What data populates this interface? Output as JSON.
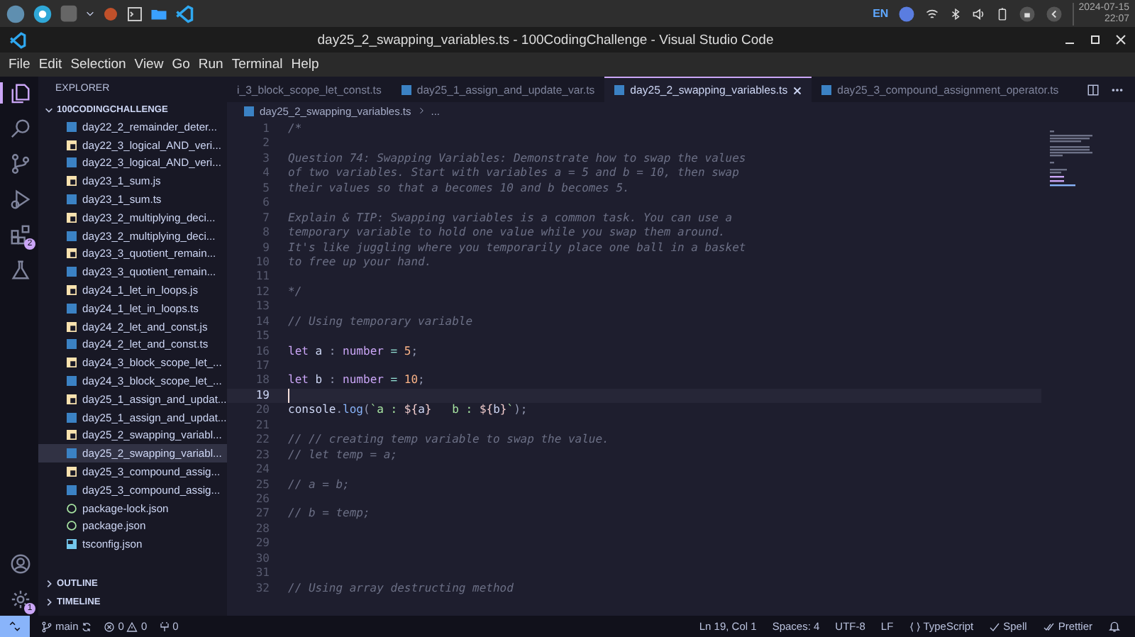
{
  "taskbar": {
    "language": "EN",
    "date": "2024-07-15",
    "time": "22:07"
  },
  "window": {
    "title": "day25_2_swapping_variables.ts - 100CodingChallenge - Visual Studio Code"
  },
  "menu": [
    "File",
    "Edit",
    "Selection",
    "View",
    "Go",
    "Run",
    "Terminal",
    "Help"
  ],
  "activity_bar": [
    {
      "kind": "explorer",
      "selected": true
    },
    {
      "kind": "search",
      "selected": false
    },
    {
      "kind": "source-control",
      "selected": false
    },
    {
      "kind": "run-debug",
      "selected": false
    },
    {
      "kind": "extensions",
      "selected": false,
      "badge": "2"
    },
    {
      "kind": "testing",
      "selected": false
    }
  ],
  "activity_bar_bottom": [
    {
      "kind": "account"
    },
    {
      "kind": "settings",
      "badge": "1"
    }
  ],
  "sidebar": {
    "title": "EXPLORER",
    "folder": {
      "name": "100CODINGCHALLENGE",
      "expanded": true
    },
    "files": [
      {
        "name": "day22_2_remainder_deter...",
        "kind": "ts",
        "selected": false
      },
      {
        "name": "day22_3_logical_AND_veri...",
        "kind": "js",
        "selected": false
      },
      {
        "name": "day22_3_logical_AND_veri...",
        "kind": "ts",
        "selected": false
      },
      {
        "name": "day23_1_sum.js",
        "kind": "js",
        "selected": false
      },
      {
        "name": "day23_1_sum.ts",
        "kind": "ts",
        "selected": false
      },
      {
        "name": "day23_2_multiplying_deci...",
        "kind": "js",
        "selected": false
      },
      {
        "name": "day23_2_multiplying_deci...",
        "kind": "ts",
        "selected": false
      },
      {
        "name": "day23_3_quotient_remain...",
        "kind": "js",
        "selected": false
      },
      {
        "name": "day23_3_quotient_remain...",
        "kind": "ts",
        "selected": false
      },
      {
        "name": "day24_1_let_in_loops.js",
        "kind": "js",
        "selected": false
      },
      {
        "name": "day24_1_let_in_loops.ts",
        "kind": "ts",
        "selected": false
      },
      {
        "name": "day24_2_let_and_const.js",
        "kind": "js",
        "selected": false
      },
      {
        "name": "day24_2_let_and_const.ts",
        "kind": "ts",
        "selected": false
      },
      {
        "name": "day24_3_block_scope_let_...",
        "kind": "js",
        "selected": false
      },
      {
        "name": "day24_3_block_scope_let_...",
        "kind": "ts",
        "selected": false
      },
      {
        "name": "day25_1_assign_and_updat...",
        "kind": "js",
        "selected": false
      },
      {
        "name": "day25_1_assign_and_updat...",
        "kind": "ts",
        "selected": false
      },
      {
        "name": "day25_2_swapping_variabl...",
        "kind": "js",
        "selected": false
      },
      {
        "name": "day25_2_swapping_variabl...",
        "kind": "ts",
        "selected": true
      },
      {
        "name": "day25_3_compound_assig...",
        "kind": "js",
        "selected": false
      },
      {
        "name": "day25_3_compound_assig...",
        "kind": "ts",
        "selected": false
      },
      {
        "name": "package-lock.json",
        "kind": "json",
        "selected": false
      },
      {
        "name": "package.json",
        "kind": "json",
        "selected": false
      },
      {
        "name": "tsconfig.json",
        "kind": "tsconfig",
        "selected": false
      }
    ],
    "sections": [
      {
        "label": "OUTLINE",
        "expanded": false
      },
      {
        "label": "TIMELINE",
        "expanded": false
      }
    ]
  },
  "tabs": [
    {
      "label": "i_3_block_scope_let_const.ts",
      "selected": false
    },
    {
      "label": "day25_1_assign_and_update_var.ts",
      "selected": false
    },
    {
      "label": "day25_2_swapping_variables.ts",
      "selected": true
    },
    {
      "label": "day25_3_compound_assignment_operator.ts",
      "selected": false
    }
  ],
  "breadcrumb": [
    "day25_2_swapping_variables.ts",
    "..."
  ],
  "code_lines": [
    {
      "number": "1",
      "current": false,
      "tokens": [
        {
          "kind": "comment",
          "text": "/*"
        }
      ]
    },
    {
      "number": "2",
      "current": false
    },
    {
      "number": "3",
      "current": false,
      "tokens": [
        {
          "kind": "comment",
          "text": "Question 74: Swapping Variables: Demonstrate how to swap the values"
        }
      ]
    },
    {
      "number": "4",
      "current": false,
      "tokens": [
        {
          "kind": "comment",
          "text": "of two variables. Start with variables a = 5 and b = 10, then swap"
        }
      ]
    },
    {
      "number": "5",
      "current": false,
      "tokens": [
        {
          "kind": "comment",
          "text": "their values so that a becomes 10 and b becomes 5."
        }
      ]
    },
    {
      "number": "6",
      "current": false
    },
    {
      "number": "7",
      "current": false,
      "tokens": [
        {
          "kind": "comment",
          "text": "Explain & TIP: Swapping variables is a common task. You can use a"
        }
      ]
    },
    {
      "number": "8",
      "current": false,
      "tokens": [
        {
          "kind": "comment",
          "text": "temporary variable to hold one value while you swap them around."
        }
      ]
    },
    {
      "number": "9",
      "current": false,
      "tokens": [
        {
          "kind": "comment",
          "text": "It's like juggling where you temporarily place one ball in a basket"
        }
      ]
    },
    {
      "number": "10",
      "current": false,
      "tokens": [
        {
          "kind": "comment",
          "text": "to free up your hand."
        }
      ]
    },
    {
      "number": "11",
      "current": false
    },
    {
      "number": "12",
      "current": false,
      "tokens": [
        {
          "kind": "comment",
          "text": "*/"
        }
      ]
    },
    {
      "number": "13",
      "current": false
    },
    {
      "number": "14",
      "current": false,
      "tokens": [
        {
          "kind": "comment",
          "text": "// Using temporary variable"
        }
      ]
    },
    {
      "number": "15",
      "current": false
    },
    {
      "number": "16",
      "current": false,
      "tokens": [
        {
          "kind": "keyword",
          "text": "let "
        },
        {
          "kind": "ident",
          "text": "a "
        },
        {
          "kind": "punct",
          "text": ": "
        },
        {
          "kind": "type",
          "text": "number "
        },
        {
          "kind": "op",
          "text": "= "
        },
        {
          "kind": "number",
          "text": "5"
        },
        {
          "kind": "punct",
          "text": ";"
        }
      ]
    },
    {
      "number": "17",
      "current": false
    },
    {
      "number": "18",
      "current": false,
      "tokens": [
        {
          "kind": "keyword",
          "text": "let "
        },
        {
          "kind": "ident",
          "text": "b "
        },
        {
          "kind": "punct",
          "text": ": "
        },
        {
          "kind": "type",
          "text": "number "
        },
        {
          "kind": "op",
          "text": "= "
        },
        {
          "kind": "number",
          "text": "10"
        },
        {
          "kind": "punct",
          "text": ";"
        }
      ]
    },
    {
      "number": "19",
      "current": true
    },
    {
      "number": "20",
      "current": false,
      "tokens": [
        {
          "kind": "ident",
          "text": "console"
        },
        {
          "kind": "punct",
          "text": "."
        },
        {
          "kind": "func",
          "text": "log"
        },
        {
          "kind": "punct",
          "text": "("
        },
        {
          "kind": "string",
          "text": "`a : "
        },
        {
          "kind": "interp",
          "text": "${"
        },
        {
          "kind": "ident",
          "text": "a"
        },
        {
          "kind": "interp",
          "text": "}"
        },
        {
          "kind": "string",
          "text": "   b : "
        },
        {
          "kind": "interp",
          "text": "${"
        },
        {
          "kind": "ident",
          "text": "b"
        },
        {
          "kind": "interp",
          "text": "}"
        },
        {
          "kind": "string",
          "text": "`"
        },
        {
          "kind": "punct",
          "text": ");"
        }
      ]
    },
    {
      "number": "21",
      "current": false
    },
    {
      "number": "22",
      "current": false,
      "tokens": [
        {
          "kind": "comment",
          "text": "// // creating temp variable to swap the value."
        }
      ]
    },
    {
      "number": "23",
      "current": false,
      "tokens": [
        {
          "kind": "comment",
          "text": "// let temp = a;"
        }
      ]
    },
    {
      "number": "24",
      "current": false
    },
    {
      "number": "25",
      "current": false,
      "tokens": [
        {
          "kind": "comment",
          "text": "// a = b;"
        }
      ]
    },
    {
      "number": "26",
      "current": false
    },
    {
      "number": "27",
      "current": false,
      "tokens": [
        {
          "kind": "comment",
          "text": "// b = temp;"
        }
      ]
    },
    {
      "number": "28",
      "current": false
    },
    {
      "number": "29",
      "current": false
    },
    {
      "number": "30",
      "current": false
    },
    {
      "number": "31",
      "current": false
    },
    {
      "number": "32",
      "current": false,
      "tokens": [
        {
          "kind": "comment",
          "text": "// Using array destructing method"
        }
      ]
    }
  ],
  "status_bar": {
    "branch": "main",
    "errors": "0",
    "warnings": "0",
    "ports": "0",
    "right": [
      {
        "kind": "text",
        "text": "Ln 19, Col 1"
      },
      {
        "kind": "text",
        "text": "Spaces: 4"
      },
      {
        "kind": "text",
        "text": "UTF-8"
      },
      {
        "kind": "text",
        "text": "LF"
      },
      {
        "kind": "language",
        "text": "TypeScript"
      },
      {
        "kind": "check",
        "text": "Spell"
      },
      {
        "kind": "double-check",
        "text": "Prettier"
      },
      {
        "kind": "bell"
      }
    ]
  }
}
